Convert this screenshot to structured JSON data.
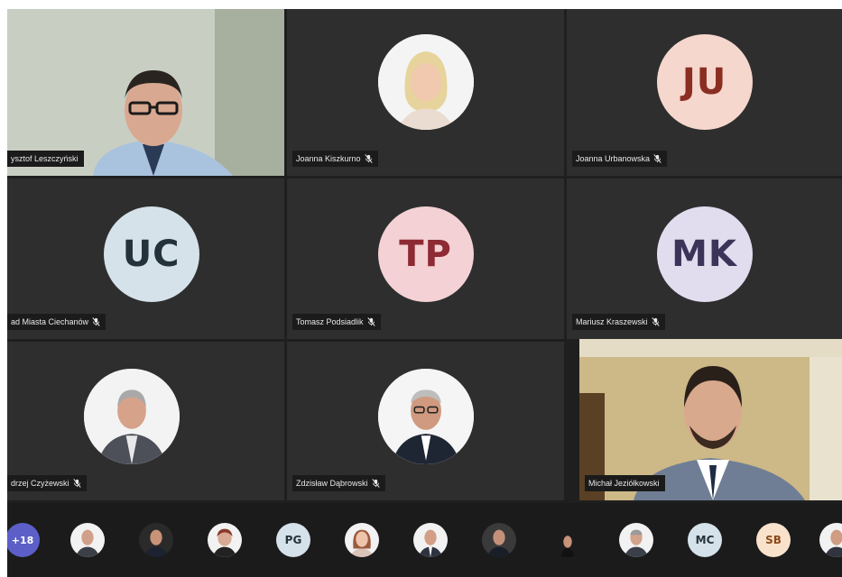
{
  "colors": {
    "tile_bg": "#2e2e2e",
    "strip_bg": "#1b1b1b",
    "overflow_badge": "#5b5fc7"
  },
  "tiles": [
    {
      "name": "ysztof Leszczyński",
      "type": "video",
      "muted": false
    },
    {
      "name": "Joanna Kiszkurno",
      "type": "photo",
      "muted": true
    },
    {
      "name": "Joanna Urbanowska",
      "type": "initials",
      "initials": "JU",
      "avatar_bg": "#f6d7cd",
      "avatar_fg": "#8a2e22",
      "muted": true
    },
    {
      "name": "ad Miasta Ciechanów",
      "type": "initials",
      "initials": "UC",
      "avatar_bg": "#d5e2ea",
      "avatar_fg": "#24323b",
      "muted": true
    },
    {
      "name": "Tomasz Podsiadlik",
      "type": "initials",
      "initials": "TP",
      "avatar_bg": "#f3d1d4",
      "avatar_fg": "#8e2a34",
      "muted": true
    },
    {
      "name": "Mariusz Kraszewski",
      "type": "initials",
      "initials": "MK",
      "avatar_bg": "#e1dcee",
      "avatar_fg": "#3c3458",
      "muted": true
    },
    {
      "name": "drzej Czyżewski",
      "type": "photo",
      "muted": true
    },
    {
      "name": "Zdzisław Dąbrowski",
      "type": "photo",
      "muted": true
    },
    {
      "name": "Michał Jeziółkowski",
      "type": "video",
      "muted": false
    }
  ],
  "strip": {
    "overflow_label": "+18",
    "initials_items": [
      {
        "initials": "PG",
        "bg": "#d5e2ea",
        "fg": "#24323b"
      },
      {
        "initials": "MC",
        "bg": "#d5e2ea",
        "fg": "#24323b"
      },
      {
        "initials": "SB",
        "bg": "#f9e2cc",
        "fg": "#8a4a1a"
      }
    ]
  }
}
